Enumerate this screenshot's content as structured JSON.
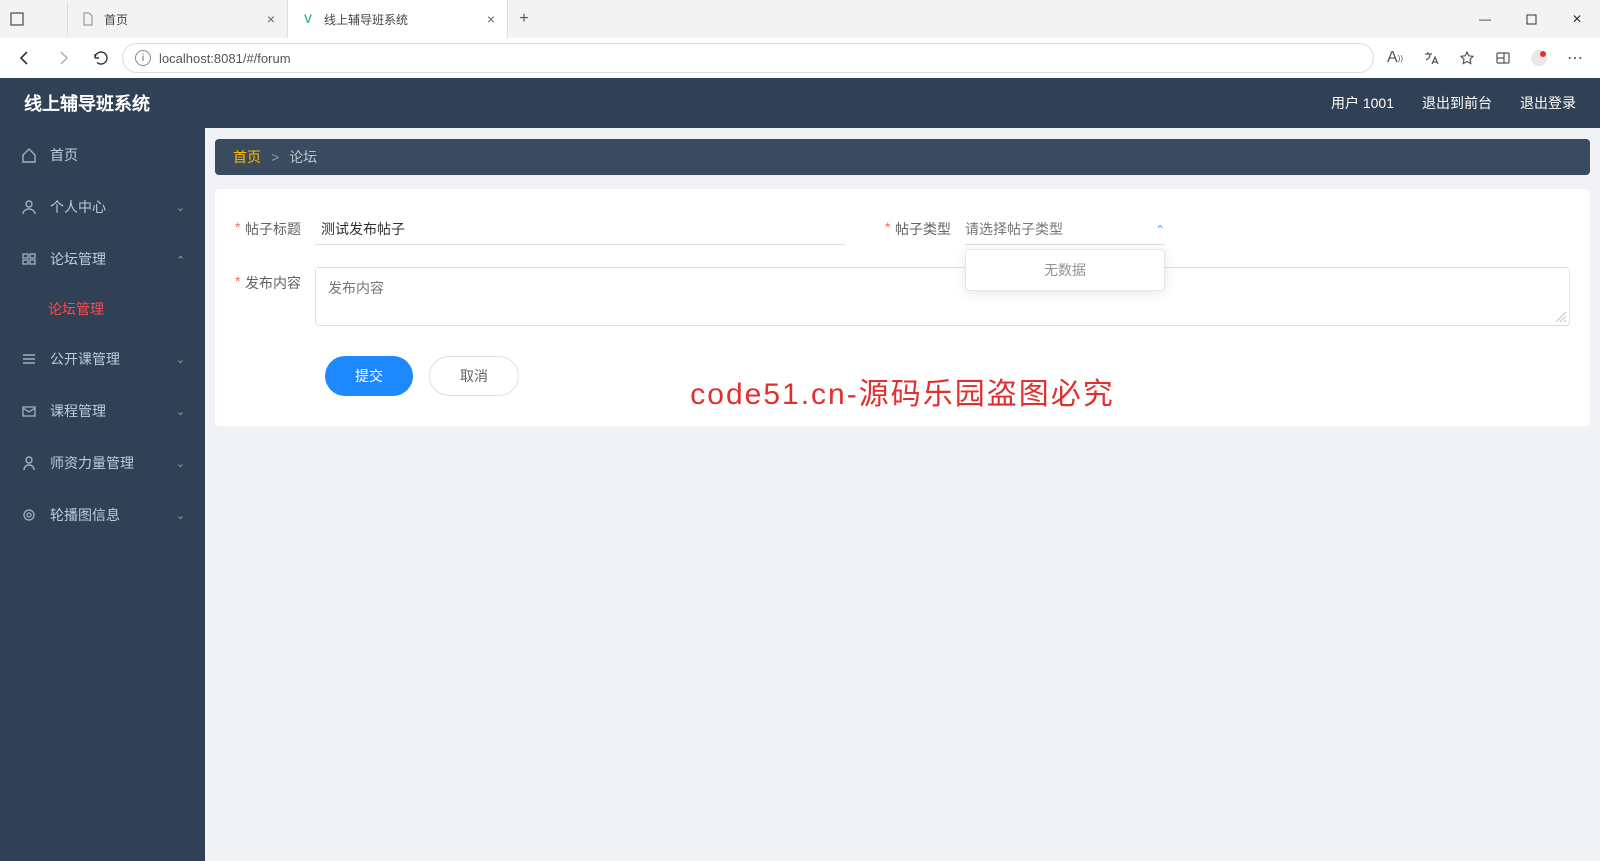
{
  "browser": {
    "tabs": [
      {
        "title": "首页",
        "favicon": "page"
      },
      {
        "title": "线上辅导班系统",
        "favicon": "vue"
      }
    ],
    "url": "localhost:8081/#/forum"
  },
  "header": {
    "title": "线上辅导班系统",
    "user_label": "用户 1001",
    "exit_front": "退出到前台",
    "logout": "退出登录"
  },
  "sidebar": {
    "home": "首页",
    "personal": "个人中心",
    "forum_mgmt": "论坛管理",
    "forum_sub": "论坛管理",
    "open_class": "公开课管理",
    "course_mgmt": "课程管理",
    "teacher_mgmt": "师资力量管理",
    "carousel": "轮播图信息"
  },
  "breadcrumb": {
    "home": "首页",
    "sep": ">",
    "current": "论坛"
  },
  "form": {
    "title_label": "帖子标题",
    "title_value": "测试发布帖子",
    "type_label": "帖子类型",
    "type_placeholder": "请选择帖子类型",
    "dropdown_empty": "无数据",
    "content_label": "发布内容",
    "content_placeholder": "发布内容",
    "submit": "提交",
    "cancel": "取消"
  },
  "watermark": "code51.cn-源码乐园盗图必究"
}
